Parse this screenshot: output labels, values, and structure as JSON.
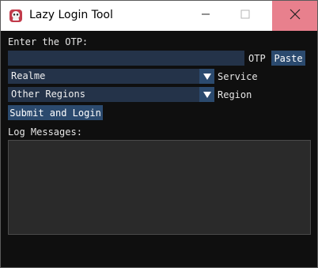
{
  "window": {
    "title": "Lazy Login Tool",
    "icon": "app-icon",
    "controls": {
      "minimize": "minimize-icon",
      "maximize": "maximize-icon",
      "close": "close-icon"
    }
  },
  "form": {
    "otp_prompt": "Enter the OTP:",
    "otp_value": "",
    "otp_label": "OTP",
    "paste_button": "Paste",
    "service_selected": "Realme",
    "service_label": "Service",
    "region_selected": "Other Regions",
    "region_label": "Region",
    "submit_button": "Submit and Login"
  },
  "log": {
    "label": "Log Messages:",
    "content": ""
  },
  "colors": {
    "field_bg": "#243349",
    "button_bg": "#2b4a6e",
    "window_bg": "#0f0f0f",
    "close_hover": "#e8808d"
  }
}
